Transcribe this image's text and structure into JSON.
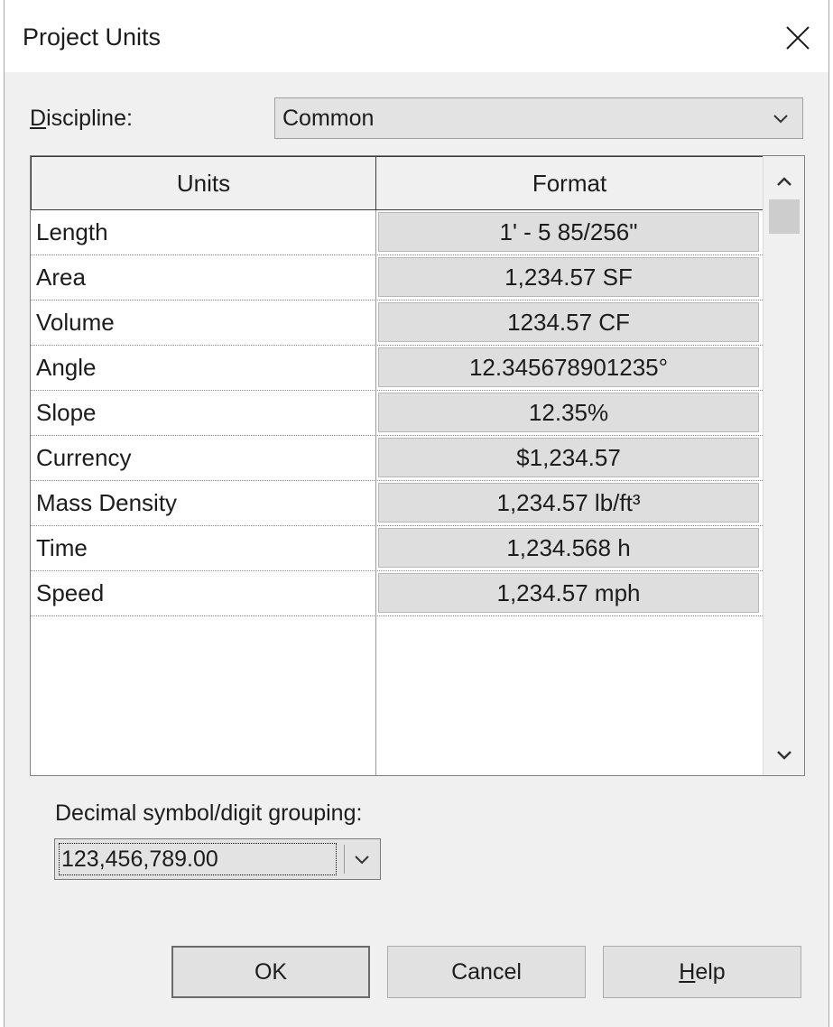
{
  "window": {
    "title": "Project Units"
  },
  "discipline": {
    "label_accel": "D",
    "label_rest": "iscipline:",
    "selected": "Common"
  },
  "table": {
    "headers": [
      "Units",
      "Format"
    ],
    "rows": [
      {
        "unit": "Length",
        "format": "1' - 5 85/256\""
      },
      {
        "unit": "Area",
        "format": "1,234.57 SF"
      },
      {
        "unit": "Volume",
        "format": "1234.57 CF"
      },
      {
        "unit": "Angle",
        "format": "12.345678901235°"
      },
      {
        "unit": "Slope",
        "format": "12.35%"
      },
      {
        "unit": "Currency",
        "format": "$1,234.57"
      },
      {
        "unit": "Mass Density",
        "format": "1,234.57 lb/ft³"
      },
      {
        "unit": "Time",
        "format": "1,234.568 h"
      },
      {
        "unit": "Speed",
        "format": "1,234.57 mph"
      }
    ]
  },
  "decimal": {
    "label_pre": "Decimal symbol/digit ",
    "label_accel": "g",
    "label_post": "rouping:",
    "selected": "123,456,789.00"
  },
  "buttons": {
    "ok": "OK",
    "cancel": "Cancel",
    "help_accel": "H",
    "help_rest": "elp"
  },
  "icons": {
    "close": "close-icon",
    "dropdown": "chevron-down-icon",
    "scroll_up": "chevron-up-icon",
    "scroll_down": "chevron-down-icon"
  }
}
